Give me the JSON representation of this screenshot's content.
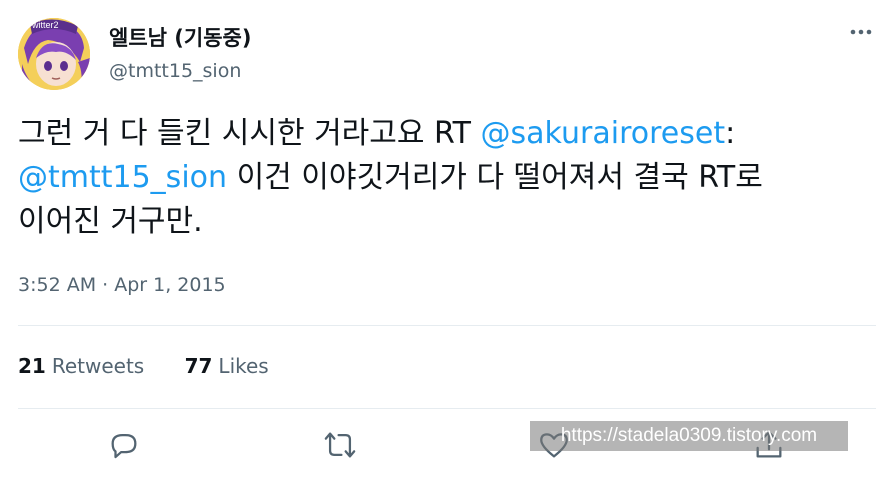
{
  "author": {
    "name": "엘트남 (기동중)",
    "handle": "@tmtt15_sion",
    "avatar_icon": "anime-avatar",
    "avatar_badge_text": "witter2"
  },
  "tweet": {
    "line1_text": "그런 거 다 들킨 시시한 거라고요 RT ",
    "line1_mention": "@sakurairoreset",
    "line1_tail": ":",
    "line2_mention": "@tmtt15_sion",
    "line2_text": " 이건 이야깃거리가 다 떨어져서 결국 RT로",
    "line3_text": "이어진 거구만."
  },
  "timestamp": "3:52 AM · Apr 1, 2015",
  "stats": {
    "retweets_count": "21",
    "retweets_label": "Retweets",
    "likes_count": "77",
    "likes_label": "Likes"
  },
  "actions": {
    "reply_icon": "reply-icon",
    "retweet_icon": "retweet-icon",
    "like_icon": "heart-icon",
    "share_icon": "share-icon"
  },
  "watermark": "https://stadela0309.tistory.com",
  "colors": {
    "link": "#1d9bf0",
    "secondary_text": "#536471",
    "primary_text": "#0f1419"
  }
}
